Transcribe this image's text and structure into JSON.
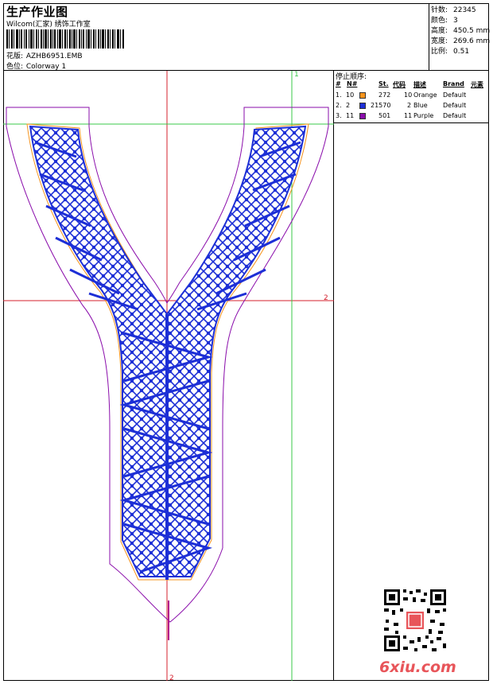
{
  "header": {
    "title": "生产作业图",
    "subtitle": "Wilcom(汇家) 绣饰工作室",
    "design_label": "花版:",
    "design_value": "AZHB6951.EMB",
    "colorway_label": "色位:",
    "colorway_value": "Colorway 1"
  },
  "stats": [
    {
      "label": "针数:",
      "value": "22345"
    },
    {
      "label": "颜色:",
      "value": "3"
    },
    {
      "label": "高度:",
      "value": "450.5 mm"
    },
    {
      "label": "宽度:",
      "value": "269.6 mm"
    },
    {
      "label": "比例:",
      "value": "0.51"
    }
  ],
  "stop_sequence": {
    "title": "停止顺序:",
    "headers": {
      "num": "#",
      "n": "N#",
      "st": "St.",
      "code": "代码",
      "desc": "描述",
      "brand": "Brand",
      "elem": "元素"
    },
    "rows": [
      {
        "idx": "1.",
        "n": "10",
        "color": "#f7941d",
        "st": "272",
        "code": "10",
        "desc": "Orange",
        "brand": "Default"
      },
      {
        "idx": "2.",
        "n": "2",
        "color": "#1d2fd6",
        "st": "21570",
        "code": "2",
        "desc": "Blue",
        "brand": "Default"
      },
      {
        "idx": "3.",
        "n": "11",
        "color": "#8a0dab",
        "st": "501",
        "code": "11",
        "desc": "Purple",
        "brand": "Default"
      }
    ]
  },
  "guides": {
    "top": "1",
    "right": "2",
    "bottom": "2"
  },
  "colors": {
    "outline": "#8a0dab",
    "orange": "#f7941d",
    "blue": "#1d2fd6",
    "guide_red": "#d4202e",
    "guide_green": "#39c84a"
  },
  "watermark": "6xiu.com"
}
